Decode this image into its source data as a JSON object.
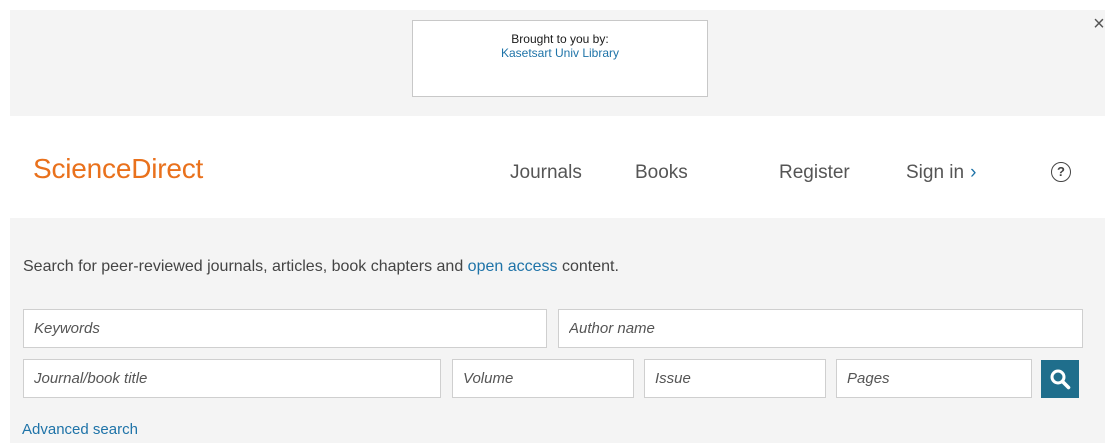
{
  "banner": {
    "brought_title": "Brought to you by:",
    "brought_link": "Kasetsart Univ Library",
    "close_glyph": "×"
  },
  "header": {
    "logo": "ScienceDirect",
    "nav": {
      "journals": "Journals",
      "books": "Books",
      "register": "Register",
      "signin": "Sign in",
      "signin_chevron": "›"
    },
    "help_glyph": "?"
  },
  "search": {
    "intro_before": "Search for peer-reviewed journals, articles, book chapters and ",
    "intro_link": "open access",
    "intro_after": " content.",
    "fields": {
      "keywords": "Keywords",
      "author": "Author name",
      "journal": "Journal/book title",
      "volume": "Volume",
      "issue": "Issue",
      "pages": "Pages"
    },
    "advanced_link": "Advanced search"
  },
  "colors": {
    "brand_orange": "#e9711c",
    "link_blue": "#1e73a8",
    "search_button": "#1f6e8c",
    "panel_bg": "#f4f4f4"
  },
  "icons": {
    "close": "close-icon",
    "help": "help-circle-icon",
    "search": "search-icon",
    "chevron": "chevron-right-icon"
  }
}
